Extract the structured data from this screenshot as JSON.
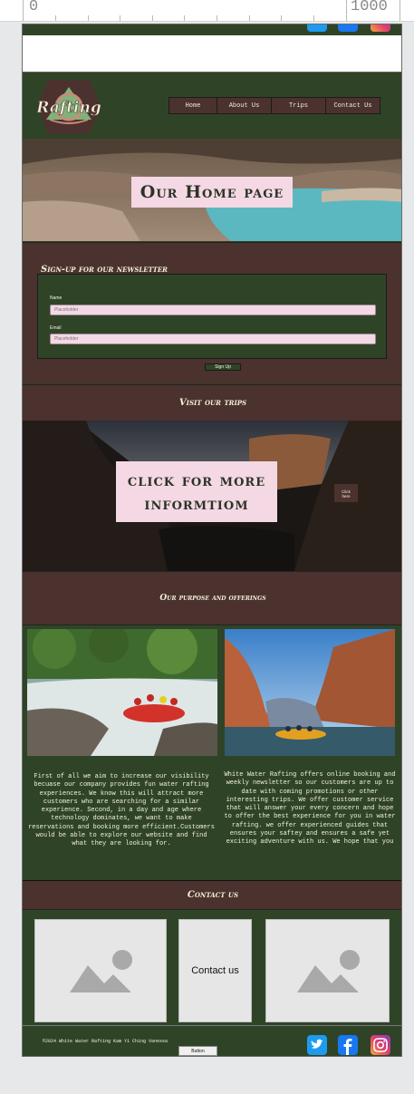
{
  "ruler": {
    "left_label": "0",
    "right_label": "1000"
  },
  "nav": {
    "items": [
      "Home",
      "About Us",
      "Trips",
      "Contact Us"
    ]
  },
  "hero": {
    "title": "Our Home page"
  },
  "newsletter": {
    "title": "Sign-up for our newsletter",
    "name_label": "Name",
    "name_placeholder": "Placeholder",
    "email_label": "Email",
    "email_placeholder": "Placeholder",
    "button": "Sign Up"
  },
  "trips": {
    "heading": "Visit our trips",
    "banner_line1": "click for more",
    "banner_line2": "informtiom",
    "button_line1": "Click",
    "button_line2": "here"
  },
  "purpose": {
    "heading": "Our purpose and offerings",
    "left_text": "First of all we aim to increase our visibility becuase our company provides fun water rafting experiences. We know this will attract more customers who are searching for a similar experience. Second, in a day and age where technology dominates, we want to make reservations and booking more efficient.Customers would be able to explore our website and find what they are looking for.",
    "right_text": "White Water Rafting offers online booking and weekly newsletter so our customers are up to date with coming promotions or other interesting trips. We offer customer service that will answer your every concern and hope to offer the best experience for you in water rafting. we offer experienced guides that ensures your saftey and ensures a safe yet exciting adventure with us. We hope that you"
  },
  "contact": {
    "heading": "Contact us",
    "card_text": "Contact us"
  },
  "footer": {
    "copyright": "©2024 White Water Rafting Kam Yi Ching Vanessa",
    "button": "Button"
  },
  "logo": {
    "text": "Rafting"
  },
  "icons": [
    "twitter-icon",
    "facebook-icon",
    "instagram-icon",
    "image-placeholder-icon"
  ],
  "colors": {
    "dark_green": "#2f4427",
    "brown": "#4b322e",
    "pink": "#f4d8e4",
    "cream": "#f4f0d8"
  }
}
